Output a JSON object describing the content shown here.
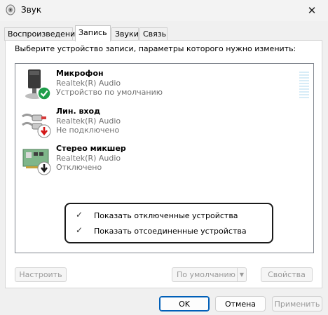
{
  "window": {
    "title": "Звук",
    "icon": "speaker-icon",
    "close_icon": "close-icon",
    "close_glyph": "✕"
  },
  "tabs": [
    {
      "label": "Воспроизведение",
      "active": false
    },
    {
      "label": "Запись",
      "active": true
    },
    {
      "label": "Звуки",
      "active": false
    },
    {
      "label": "Связь",
      "active": false
    }
  ],
  "panel": {
    "prompt": "Выберите устройство записи, параметры которого нужно изменить:"
  },
  "devices": [
    {
      "name": "Микрофон",
      "driver": "Realtek(R) Audio",
      "status": "Устройство по умолчанию",
      "icon": "microphone-icon",
      "badge": "default-check-icon",
      "badge_color": "#1e9e4a"
    },
    {
      "name": "Лин. вход",
      "driver": "Realtek(R) Audio",
      "status": "Не подключено",
      "icon": "line-in-cable-icon",
      "badge": "unplugged-arrow-icon",
      "badge_color": "#d31717"
    },
    {
      "name": "Стерео микшер",
      "driver": "Realtek(R) Audio",
      "status": "Отключено",
      "icon": "sound-card-icon",
      "badge": "disabled-arrow-icon",
      "badge_color": "#1a1a1a"
    }
  ],
  "context_menu": {
    "items": [
      {
        "label": "Показать отключенные устройства",
        "checked": true
      },
      {
        "label": "Показать отсоединенные устройства",
        "checked": true
      }
    ],
    "check_glyph": "✓"
  },
  "panel_buttons": {
    "configure": "Настроить",
    "set_default": "По умолчанию",
    "split_arrow_glyph": "▼",
    "properties": "Свойства"
  },
  "dialog_buttons": {
    "ok": "OK",
    "cancel": "Отмена",
    "apply": "Применить"
  },
  "colors": {
    "accent": "#005fb8",
    "default_badge": "#1e9e4a",
    "unplugged_badge": "#d31717",
    "level_meter": "#d7ecf7"
  }
}
